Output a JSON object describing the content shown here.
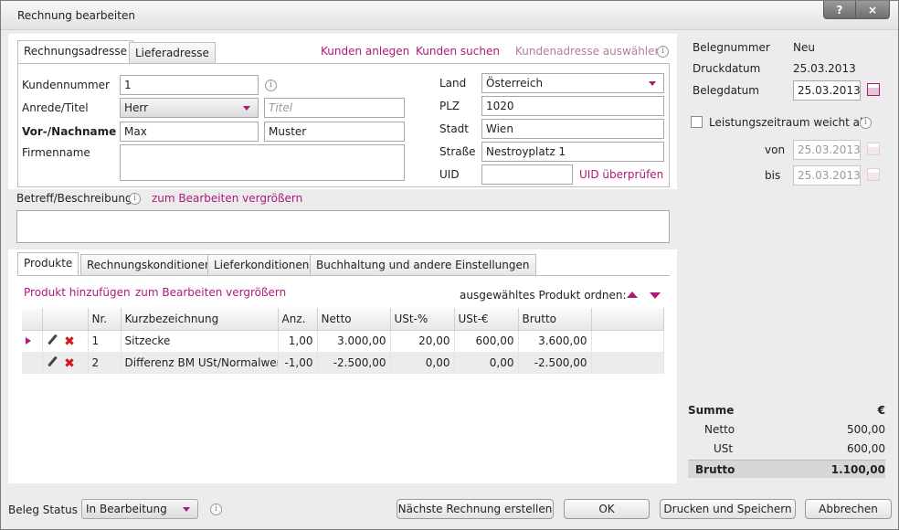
{
  "window": {
    "title": "Rechnung bearbeiten",
    "help": "?",
    "close": "×"
  },
  "address": {
    "tabs": [
      "Rechnungsadresse",
      "Lieferadresse"
    ],
    "actions": {
      "create": "Kunden anlegen",
      "search": "Kunden suchen",
      "select": "Kundenadresse auswählen"
    },
    "fields": {
      "kundennummer_label": "Kundennummer",
      "kundennummer": "1",
      "anrede_label": "Anrede/Titel",
      "anrede": "Herr",
      "titel_placeholder": "Titel",
      "name_label": "Vor-/Nachname",
      "vorname": "Max",
      "nachname": "Muster",
      "firma_label": "Firmenname",
      "firma": "",
      "land_label": "Land",
      "land": "Österreich",
      "plz_label": "PLZ",
      "plz": "1020",
      "stadt_label": "Stadt",
      "stadt": "Wien",
      "strasse_label": "Straße",
      "strasse": "Nestroyplatz 1",
      "uid_label": "UID",
      "uid": "",
      "uid_check": "UID überprüfen"
    }
  },
  "beleg": {
    "nummer_label": "Belegnummer",
    "nummer": "Neu",
    "druckdatum_label": "Druckdatum",
    "druckdatum": "25.03.2013",
    "belegdatum_label": "Belegdatum",
    "belegdatum": "25.03.2013",
    "leistung_label": "Leistungszeitraum weicht ab",
    "von_label": "von",
    "von": "25.03.2013",
    "bis_label": "bis",
    "bis": "25.03.2013"
  },
  "betreff": {
    "label": "Betreff/Beschreibung",
    "enlarge": "zum Bearbeiten vergrößern",
    "value": ""
  },
  "products": {
    "tabs": [
      "Produkte",
      "Rechnungskonditionen",
      "Lieferkonditionen",
      "Buchhaltung und andere Einstellungen"
    ],
    "add": "Produkt hinzufügen",
    "enlarge": "zum Bearbeiten vergrößern",
    "order": "ausgewähltes Produkt ordnen:",
    "columns": [
      "Nr.",
      "Kurzbezeichnung",
      "Anz.",
      "Netto",
      "USt-%",
      "USt-€",
      "Brutto"
    ],
    "rows": [
      {
        "nr": "1",
        "name": "Sitzecke",
        "anz": "1,00",
        "netto": "3.000,00",
        "ust_pct": "20,00",
        "ust_eur": "600,00",
        "brutto": "3.600,00"
      },
      {
        "nr": "2",
        "name": "Differenz BM USt/Normalwert",
        "anz": "-1,00",
        "netto": "-2.500,00",
        "ust_pct": "0,00",
        "ust_eur": "0,00",
        "brutto": "-2.500,00"
      }
    ]
  },
  "summary": {
    "title": "Summe",
    "currency": "€",
    "netto_label": "Netto",
    "netto": "500,00",
    "ust_label": "USt",
    "ust": "600,00",
    "brutto_label": "Brutto",
    "brutto": "1.100,00"
  },
  "footer": {
    "status_label": "Beleg Status",
    "status": "In Bearbeitung",
    "next": "Nächste Rechnung erstellen",
    "ok": "OK",
    "print_save": "Drucken und Speichern",
    "cancel": "Abbrechen"
  }
}
